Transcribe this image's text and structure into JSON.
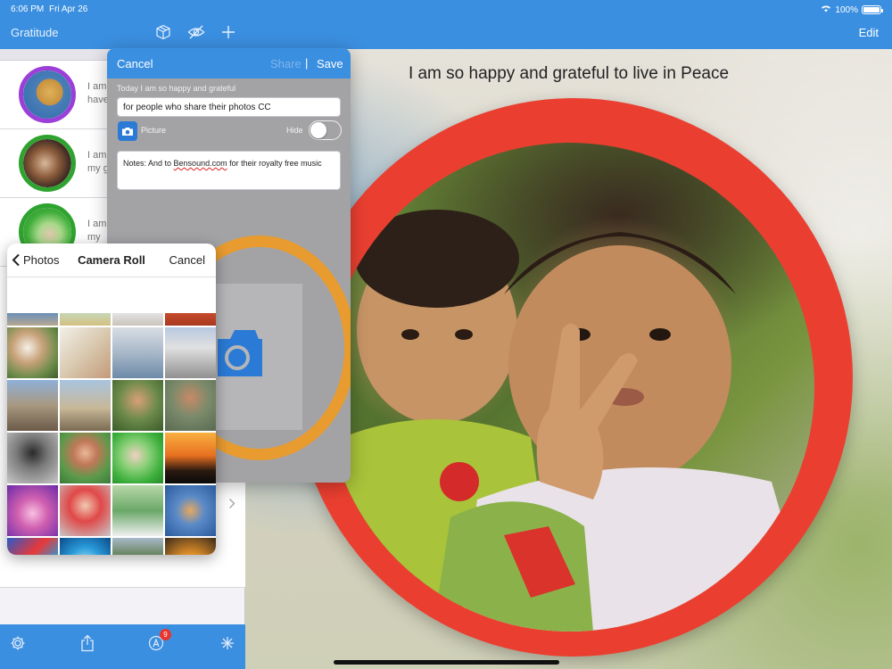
{
  "status": {
    "time": "6:06 PM",
    "date": "Fri Apr 26",
    "battery": "100%",
    "battery_level": 1.0
  },
  "header": {
    "app_title": "Gratitude",
    "edit_label": "Edit",
    "icons": [
      "cube-icon",
      "hidden-eye-icon",
      "plus-icon"
    ]
  },
  "main": {
    "headline": "I am so happy and grateful to live in Peace"
  },
  "sidebar": {
    "items": [
      {
        "text_line1": "I am",
        "text_line2": "have",
        "avatar": "giraffe"
      },
      {
        "text_line1": "I am",
        "text_line2": "my g",
        "avatar": "wedding"
      },
      {
        "text_line1": "I am",
        "text_line2": "my",
        "avatar": "hand"
      }
    ]
  },
  "popover": {
    "cancel_label": "Cancel",
    "share_label": "Share",
    "separator": "|",
    "save_label": "Save",
    "prompt": "Today I am so happy and grateful",
    "entry_value": "for people who share their photos CC",
    "picture_label": "Picture",
    "hide_label": "Hide",
    "hide_on": false,
    "notes_before": "Notes: And to ",
    "notes_link": "Bensound.com",
    "notes_after": " for their royalty free music"
  },
  "picker": {
    "back_label": "Photos",
    "title": "Camera Roll",
    "cancel_label": "Cancel"
  },
  "toolbar": {
    "icons": [
      "settings-icon",
      "share-icon",
      "app-store-icon",
      "sparkle-icon"
    ],
    "badge_count": "9"
  },
  "colors": {
    "accent": "#3b8fe0",
    "ring": "#ea3f30",
    "avatar_border": "#2fa32f",
    "avatar_border_alt": "#9b3fd8",
    "preview_ring": "#e89b2f",
    "badge": "#e8362c"
  }
}
